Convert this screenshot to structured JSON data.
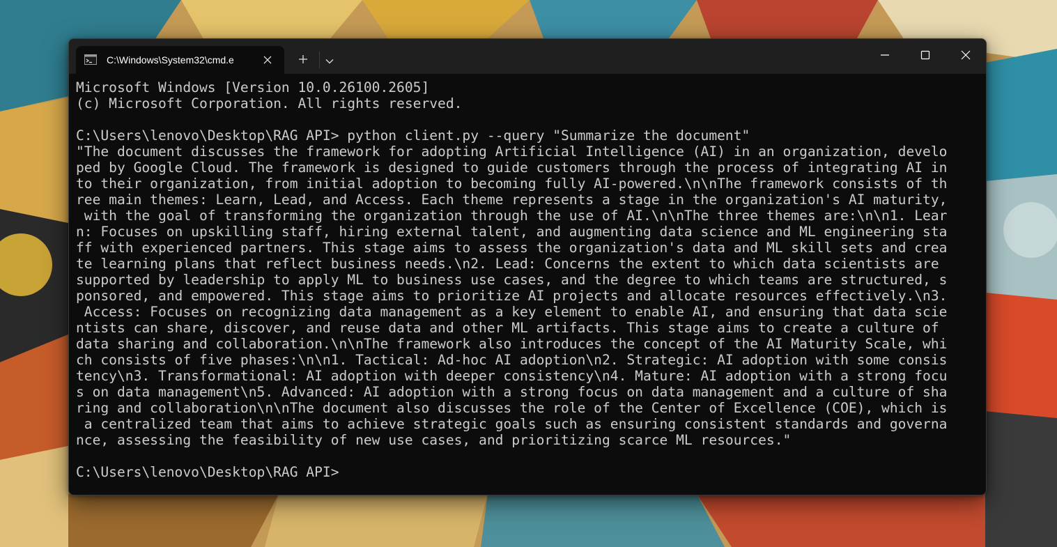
{
  "window": {
    "tab_title": "C:\\Windows\\System32\\cmd.e",
    "icons": {
      "tab": "cmd-icon",
      "tab_close": "close-icon",
      "new_tab": "plus-icon",
      "dropdown": "chevron-down-icon",
      "minimize": "minimize-icon",
      "maximize": "maximize-icon",
      "close": "close-icon"
    }
  },
  "console": {
    "lines": [
      "Microsoft Windows [Version 10.0.26100.2605]",
      "(c) Microsoft Corporation. All rights reserved.",
      "",
      "C:\\Users\\lenovo\\Desktop\\RAG API> python client.py --query \"Summarize the document\"",
      "\"The document discusses the framework for adopting Artificial Intelligence (AI) in an organization, develo",
      "ped by Google Cloud. The framework is designed to guide customers through the process of integrating AI in",
      "to their organization, from initial adoption to becoming fully AI-powered.\\n\\nThe framework consists of th",
      "ree main themes: Learn, Lead, and Access. Each theme represents a stage in the organization's AI maturity,",
      " with the goal of transforming the organization through the use of AI.\\n\\nThe three themes are:\\n\\n1. Lear",
      "n: Focuses on upskilling staff, hiring external talent, and augmenting data science and ML engineering sta",
      "ff with experienced partners. This stage aims to assess the organization's data and ML skill sets and crea",
      "te learning plans that reflect business needs.\\n2. Lead: Concerns the extent to which data scientists are",
      "supported by leadership to apply ML to business use cases, and the degree to which teams are structured, s",
      "ponsored, and empowered. This stage aims to prioritize AI projects and allocate resources effectively.\\n3.",
      " Access: Focuses on recognizing data management as a key element to enable AI, and ensuring that data scie",
      "ntists can share, discover, and reuse data and other ML artifacts. This stage aims to create a culture of",
      "data sharing and collaboration.\\n\\nThe framework also introduces the concept of the AI Maturity Scale, whi",
      "ch consists of five phases:\\n\\n1. Tactical: Ad-hoc AI adoption\\n2. Strategic: AI adoption with some consis",
      "tency\\n3. Transformational: AI adoption with deeper consistency\\n4. Mature: AI adoption with a strong focu",
      "s on data management\\n5. Advanced: AI adoption with a strong focus on data management and a culture of sha",
      "ring and collaboration\\n\\nThe document also discusses the role of the Center of Excellence (COE), which is",
      " a centralized team that aims to achieve strategic goals such as ensuring consistent standards and governa",
      "nce, assessing the feasibility of new use cases, and prioritizing scarce ML resources.\"",
      "",
      "C:\\Users\\lenovo\\Desktop\\RAG API>"
    ]
  },
  "colors": {
    "console_bg": "#0c0c0c",
    "console_text": "#cccccc",
    "titlebar_bg": "#1f1f1f",
    "tab_text": "#ffffff"
  }
}
